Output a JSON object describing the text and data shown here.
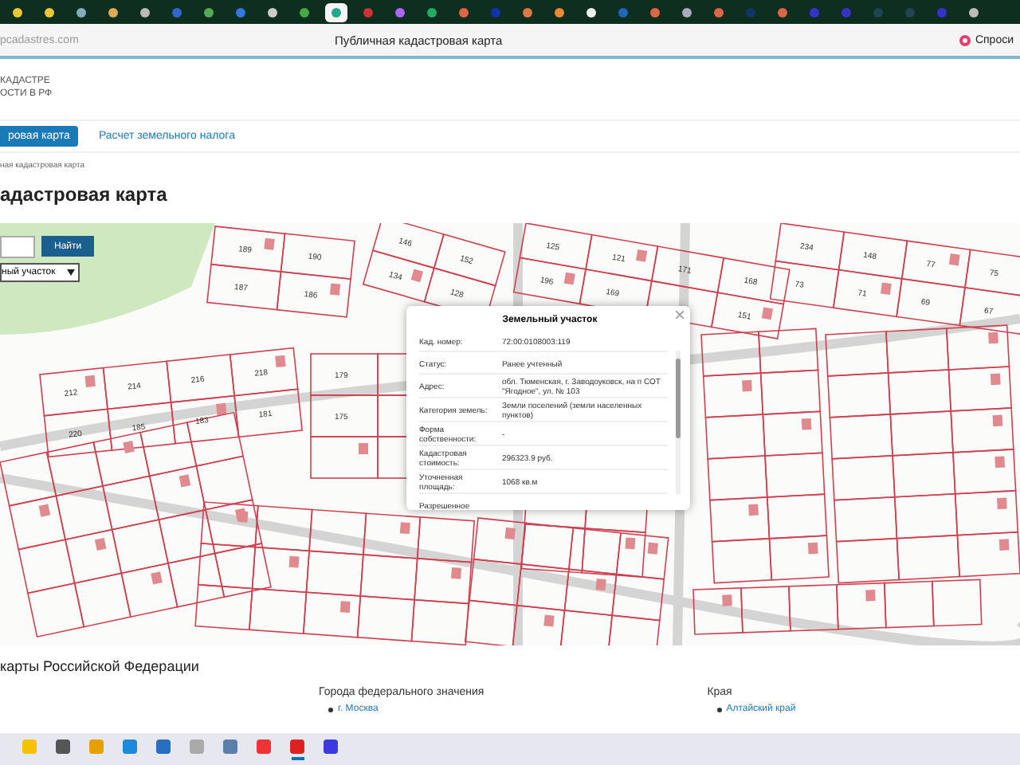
{
  "browser_tabs": [
    {
      "selected": false
    },
    {
      "selected": false
    },
    {
      "selected": false
    },
    {
      "selected": false
    },
    {
      "selected": false
    },
    {
      "selected": false
    },
    {
      "selected": false
    },
    {
      "selected": false
    },
    {
      "selected": false
    },
    {
      "selected": false
    },
    {
      "selected": true
    },
    {
      "selected": false
    },
    {
      "selected": false
    },
    {
      "selected": false
    },
    {
      "selected": false
    },
    {
      "selected": false
    },
    {
      "selected": false
    },
    {
      "selected": false
    },
    {
      "selected": false
    },
    {
      "selected": false
    },
    {
      "selected": false
    },
    {
      "selected": false
    },
    {
      "selected": false
    },
    {
      "selected": false
    },
    {
      "selected": false
    },
    {
      "selected": false
    },
    {
      "selected": false
    },
    {
      "selected": false
    },
    {
      "selected": false
    },
    {
      "selected": false
    },
    {
      "selected": false
    }
  ],
  "address_bar": {
    "url": "pcadastres.com",
    "page_title": "Публичная кадастровая карта",
    "ask_button": "Спроси"
  },
  "header": {
    "logo_lines": [
      "КАДАСТРЕ",
      "ОСТИ В РФ"
    ]
  },
  "nav": [
    {
      "label": "ровая карта",
      "selected": true
    },
    {
      "label": "Расчет земельного налога",
      "selected": false
    }
  ],
  "breadcrumb": "ная кадастровая карта",
  "heading": "адастровая карта",
  "map": {
    "search_button": "Найти",
    "type_select": "ный участок",
    "parcels": [
      {
        "label": "189"
      },
      {
        "label": "190"
      },
      {
        "label": "187"
      },
      {
        "label": "186"
      },
      {
        "label": "146"
      },
      {
        "label": "152"
      },
      {
        "label": "134"
      },
      {
        "label": "128"
      },
      {
        "label": "125"
      },
      {
        "label": "121"
      },
      {
        "label": "171"
      },
      {
        "label": "168"
      },
      {
        "label": "196"
      },
      {
        "label": "169"
      },
      {
        "label": "151"
      },
      {
        "label": "234"
      },
      {
        "label": "148"
      },
      {
        "label": "77"
      },
      {
        "label": "75"
      },
      {
        "label": "73"
      },
      {
        "label": "71"
      },
      {
        "label": "69"
      },
      {
        "label": "67"
      },
      {
        "label": "212"
      },
      {
        "label": "214"
      },
      {
        "label": "216"
      },
      {
        "label": "218"
      },
      {
        "label": "220"
      },
      {
        "label": "185"
      },
      {
        "label": "183"
      },
      {
        "label": "181"
      },
      {
        "label": "179"
      },
      {
        "label": "175"
      }
    ],
    "popup": {
      "title": "Земельный участок",
      "rows": [
        {
          "label": "Кад. номер:",
          "value": "72:00:0108003:119"
        },
        {
          "label": "Статус:",
          "value": "Ранее учтенный"
        },
        {
          "label": "Адрес:",
          "value": "обл. Тюменская, г. Заводоуковск, на п СОТ \"Ягодное\", ул. № 103"
        },
        {
          "label": "Категория земель:",
          "value": "Земли поселений (земли населенных пунктов)"
        },
        {
          "label": "Форма собственности:",
          "value": "-"
        },
        {
          "label": "Кадастровая стоимость:",
          "value": "296323.9 руб."
        },
        {
          "label": "Уточненная площадь:",
          "value": "1068 кв.м"
        },
        {
          "label": "Разрешенное"
        }
      ]
    }
  },
  "footer": {
    "title": "карты Российской Федерации",
    "columns": [
      {
        "heading": "Города федерального значения",
        "links": [
          "г. Москва"
        ]
      },
      {
        "heading": "Края",
        "links": [
          "Алтайский край"
        ]
      }
    ]
  },
  "taskbar_apps": [
    {
      "active": false
    },
    {
      "active": false
    },
    {
      "active": false
    },
    {
      "active": false
    },
    {
      "active": false
    },
    {
      "active": false
    },
    {
      "active": false
    },
    {
      "active": false
    },
    {
      "active": true
    },
    {
      "active": false
    }
  ]
}
